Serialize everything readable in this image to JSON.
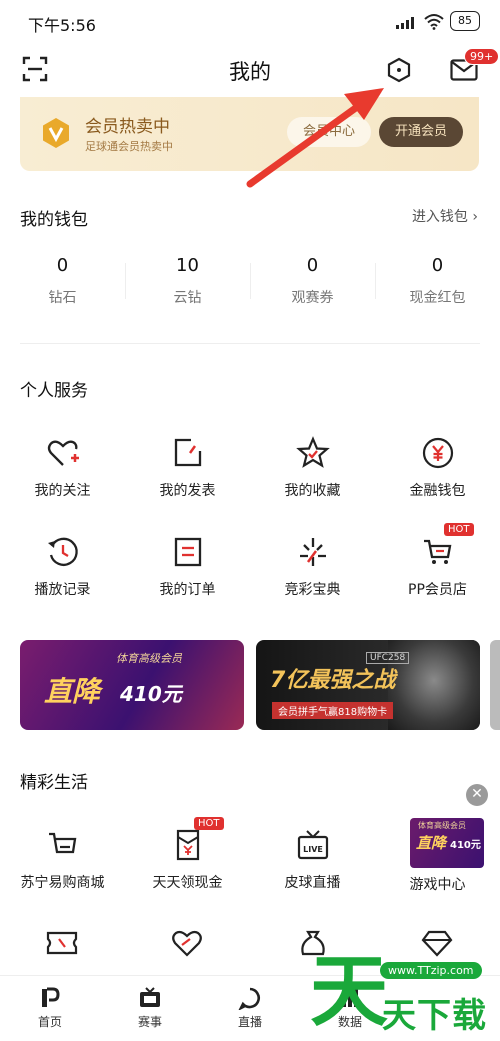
{
  "status_bar": {
    "time": "下午5:56",
    "battery": "85"
  },
  "header": {
    "title": "我的",
    "mail_badge": "99+"
  },
  "vip_banner": {
    "title": "会员热卖中",
    "subtitle": "足球通会员热卖中",
    "center_button": "会员中心",
    "open_button": "开通会员"
  },
  "wallet": {
    "title": "我的钱包",
    "link": "进入钱包",
    "items": [
      {
        "value": "0",
        "label": "钻石"
      },
      {
        "value": "10",
        "label": "云钻"
      },
      {
        "value": "0",
        "label": "观赛券"
      },
      {
        "value": "0",
        "label": "现金红包"
      }
    ]
  },
  "services": {
    "title": "个人服务",
    "items": [
      {
        "label": "我的关注",
        "icon": "heart-plus-icon"
      },
      {
        "label": "我的发表",
        "icon": "edit-icon"
      },
      {
        "label": "我的收藏",
        "icon": "star-icon"
      },
      {
        "label": "金融钱包",
        "icon": "yen-coin-icon"
      },
      {
        "label": "播放记录",
        "icon": "history-icon"
      },
      {
        "label": "我的订单",
        "icon": "order-icon"
      },
      {
        "label": "竞彩宝典",
        "icon": "sparkle-icon"
      },
      {
        "label": "PP会员店",
        "icon": "cart-icon",
        "badge": "HOT"
      }
    ]
  },
  "promos": {
    "first": {
      "top": "体育高级会员",
      "main": "直降",
      "amount": "410元"
    },
    "second": {
      "main": "亿最强之战",
      "prefix": "7",
      "sub": "会员拼手气赢818购物卡",
      "tag": "UFC258"
    }
  },
  "life": {
    "title": "精彩生活",
    "close": "✕",
    "items": [
      {
        "label": "苏宁易购商城",
        "icon": "shopping-cart-icon"
      },
      {
        "label": "天天领现金",
        "icon": "cash-envelope-icon",
        "badge": "HOT"
      },
      {
        "label": "皮球直播",
        "icon": "live-tv-icon"
      },
      {
        "label": "游戏中心",
        "icon": "game-banner-icon"
      }
    ],
    "game_banner": {
      "top": "体育高级会员",
      "main": "直降",
      "amount": "410元"
    }
  },
  "tabbar": {
    "items": [
      {
        "label": "首页",
        "icon": "home-p-icon"
      },
      {
        "label": "赛事",
        "icon": "tv-icon"
      },
      {
        "label": "直播",
        "icon": "live-bubble-icon"
      },
      {
        "label": "数据",
        "icon": "data-icon"
      }
    ]
  },
  "watermark": {
    "big": "天",
    "text": "天下载",
    "url": "www.TTzip.com"
  },
  "colors": {
    "accent": "#e0312f",
    "vip_gold": "#8a5a1e",
    "watermark_green": "#1aa83a"
  }
}
